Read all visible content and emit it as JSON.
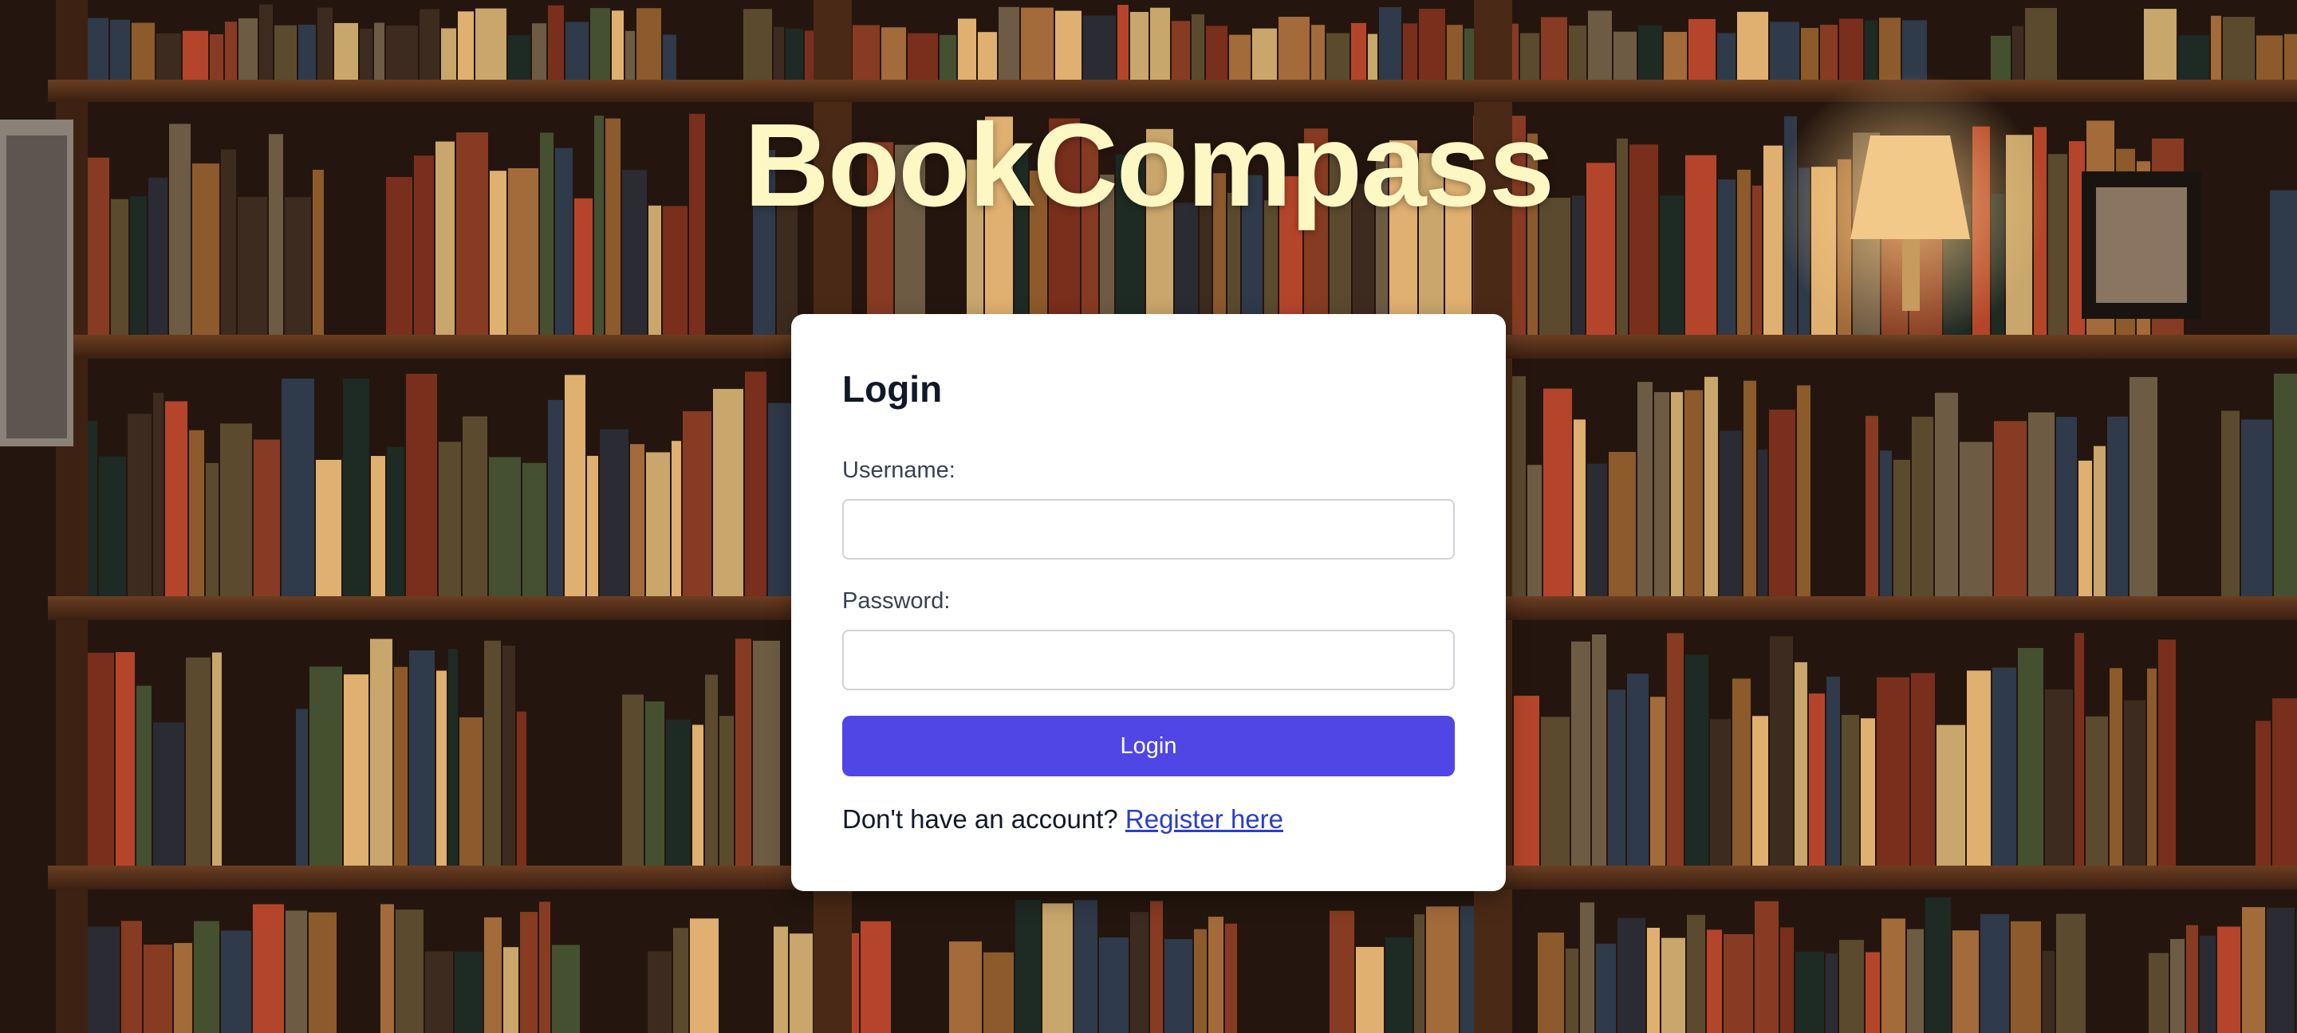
{
  "brand": {
    "title": "BookCompass"
  },
  "login_form": {
    "heading": "Login",
    "username_label": "Username:",
    "username_value": "",
    "password_label": "Password:",
    "password_value": "",
    "submit_label": "Login",
    "register_prompt": "Don't have an account?",
    "register_link": "Register here"
  },
  "colors": {
    "brand_title": "#fdf7c3",
    "primary_button": "#4f46e5",
    "link": "#2b3ec9"
  }
}
